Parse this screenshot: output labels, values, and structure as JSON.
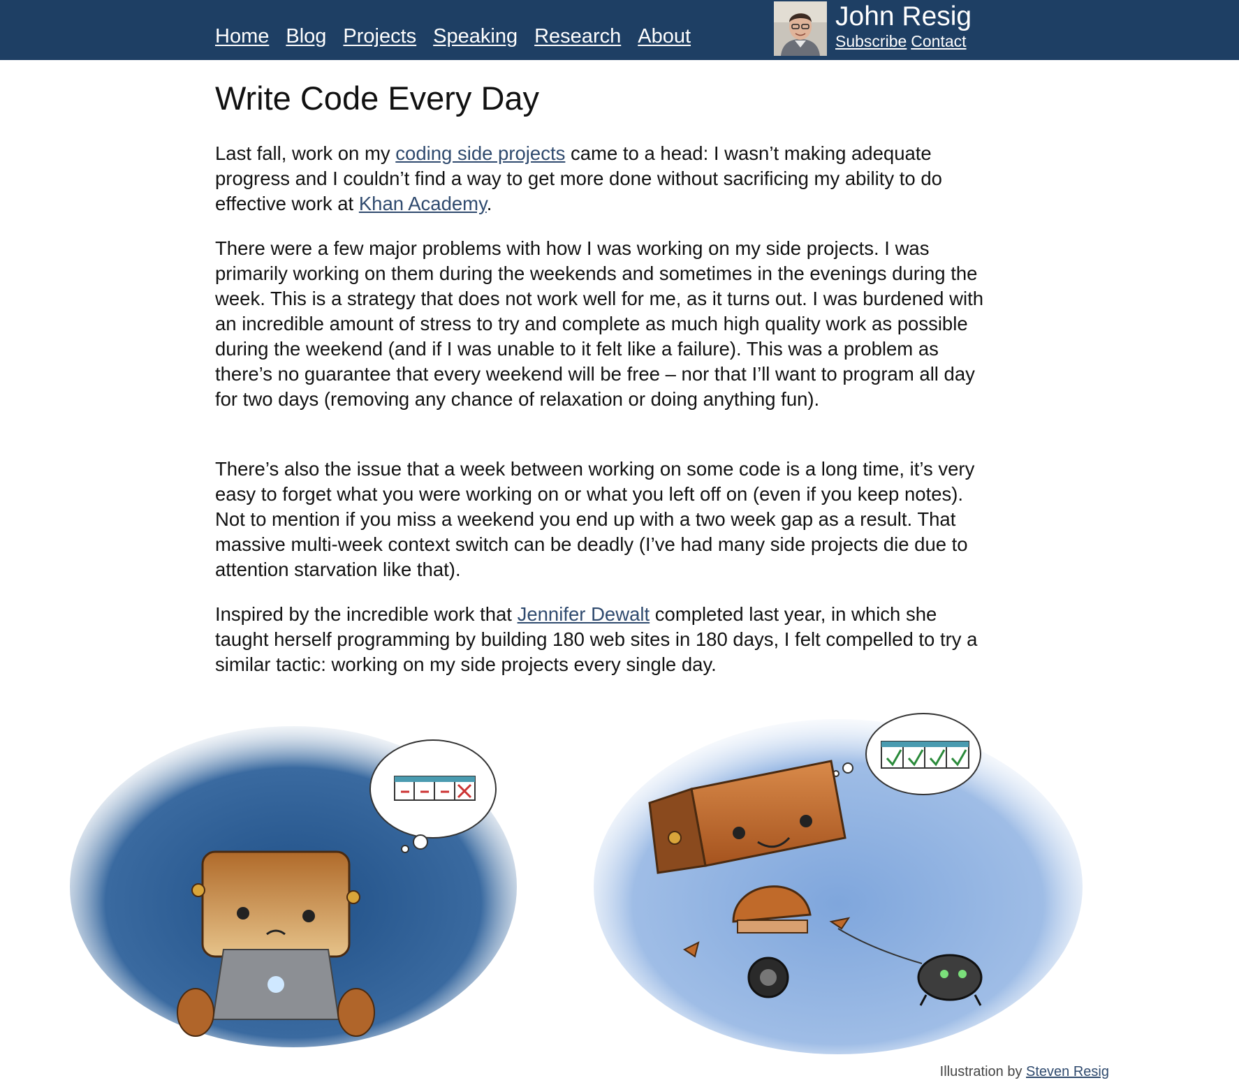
{
  "nav": {
    "items": [
      {
        "label": "Home"
      },
      {
        "label": "Blog"
      },
      {
        "label": "Projects"
      },
      {
        "label": "Speaking"
      },
      {
        "label": "Research"
      },
      {
        "label": "About"
      }
    ]
  },
  "header": {
    "site_name": "John Resig",
    "subscribe_label": "Subscribe",
    "contact_label": "Contact"
  },
  "article": {
    "title": "Write Code Every Day",
    "p1": {
      "a": "Last fall, work on my ",
      "link1": "coding side projects",
      "b": " came to a head: I wasn’t making adequate progress and I couldn’t find a way to get more done without sacrificing my ability to do effective work at ",
      "link2": "Khan Academy",
      "c": "."
    },
    "p2": "There were a few major problems with how I was working on my side projects. I was primarily working on them during the weekends and sometimes in the evenings during the week. This is a strategy that does not work well for me, as it turns out. I was burdened with an incredible amount of stress to try and complete as much high quality work as possible during the weekend (and if I was unable to it felt like a failure). This was a problem as there’s no guarantee that every weekend will be free – nor that I’ll want to program all day for two days (removing any chance of relaxation or doing anything fun).",
    "p3": "There’s also the issue that a week between working on some code is a long time, it’s very easy to forget what you were working on or what you left off on (even if you keep notes). Not to mention if you miss a weekend you end up with a two week gap as a result. That massive multi-week context switch can be deadly (I’ve had many side projects die due to attention starvation like that).",
    "p4": {
      "a": "Inspired by the incredible work that ",
      "link": "Jennifer Dewalt",
      "b": " completed last year, in which she taught herself programming by building 180 web sites in 180 days, I felt compelled to try a similar tactic: working on my side projects every single day."
    }
  },
  "illustration": {
    "caption_prefix": "Illustration by ",
    "caption_link": "Steven Resig"
  },
  "colors": {
    "header_bg": "#1e3f64",
    "link": "#2f4a6e"
  }
}
